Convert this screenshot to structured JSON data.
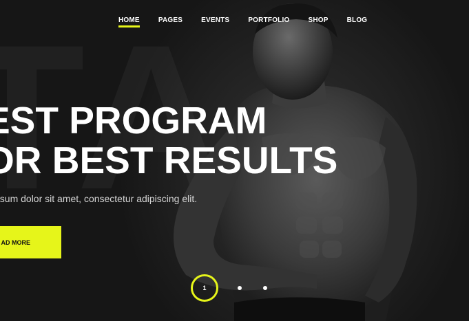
{
  "nav": {
    "items": [
      {
        "label": "HOME",
        "active": true
      },
      {
        "label": "PAGES",
        "active": false
      },
      {
        "label": "EVENTS",
        "active": false
      },
      {
        "label": "PORTFOLIO",
        "active": false
      },
      {
        "label": "SHOP",
        "active": false
      },
      {
        "label": "BLOG",
        "active": false
      }
    ]
  },
  "hero": {
    "headline_line1": "EST PROGRAM",
    "headline_line2": "OR BEST RESULTS",
    "subtitle": "psum dolor sit amet, consectetur adipiscing elit.",
    "cta_label": "AD MORE",
    "watermark": "TA"
  },
  "slider": {
    "current_page": "1",
    "total_dots": 3
  },
  "colors": {
    "accent": "#e6f51a",
    "text": "#ffffff",
    "background": "#1a1a1a"
  }
}
